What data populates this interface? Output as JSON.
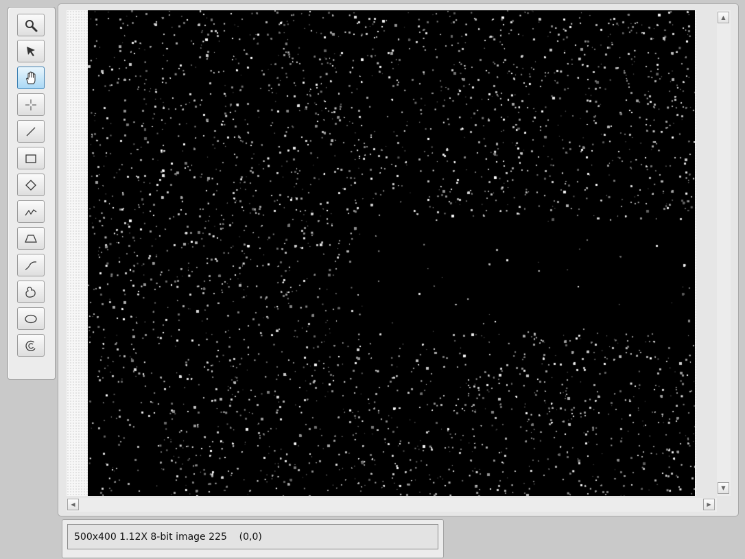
{
  "toolbar": {
    "tools": [
      {
        "id": "zoom",
        "icon": "magnifier-icon",
        "active": false
      },
      {
        "id": "select",
        "icon": "arrow-pointer-icon",
        "active": false
      },
      {
        "id": "pan",
        "icon": "hand-icon",
        "active": true
      },
      {
        "id": "point",
        "icon": "crosshair-icon",
        "active": false
      },
      {
        "id": "line",
        "icon": "line-icon",
        "active": false
      },
      {
        "id": "rectangle",
        "icon": "rectangle-icon",
        "active": false
      },
      {
        "id": "rotated-rectangle",
        "icon": "diamond-icon",
        "active": false
      },
      {
        "id": "polyline",
        "icon": "polyline-icon",
        "active": false
      },
      {
        "id": "polygon",
        "icon": "polygon-icon",
        "active": false
      },
      {
        "id": "freehand-line",
        "icon": "freehand-line-icon",
        "active": false
      },
      {
        "id": "freehand-region",
        "icon": "freehand-region-icon",
        "active": false
      },
      {
        "id": "oval",
        "icon": "oval-icon",
        "active": false
      },
      {
        "id": "annulus",
        "icon": "annulus-icon",
        "active": false
      }
    ]
  },
  "image": {
    "description_colors": {
      "background": "#000000",
      "speckle": "#ffffff"
    }
  },
  "scrollbars": {
    "up_glyph": "▲",
    "down_glyph": "▼",
    "left_glyph": "◀",
    "right_glyph": "▶"
  },
  "status": {
    "text": "500x400 1.12X 8-bit image 225    (0,0)"
  },
  "colors": {
    "active_tool": "#a9d8f5",
    "window_bg": "#c9c9c9",
    "panel_bg": "#ececec"
  }
}
